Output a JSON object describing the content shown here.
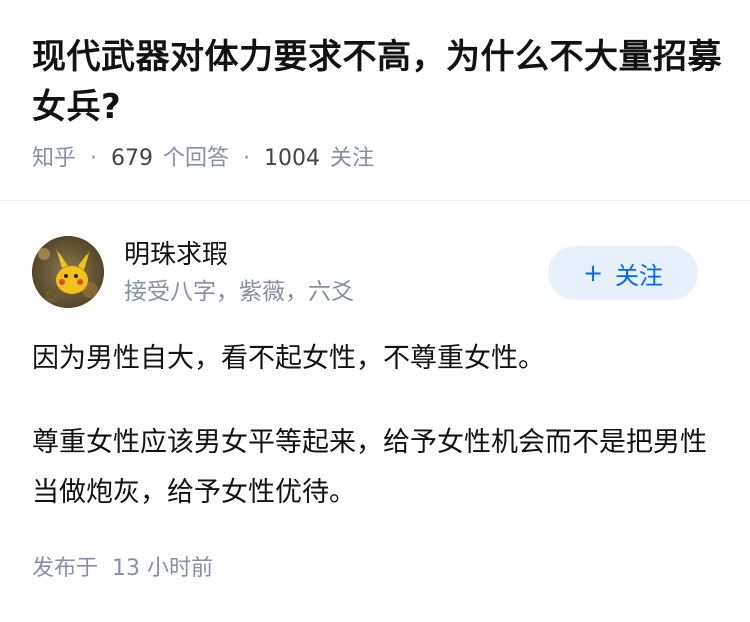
{
  "question": {
    "title": "现代武器对体力要求不高，为什么不大量招募女兵?",
    "source": "知乎",
    "answer_count": "679",
    "answer_label": "个回答",
    "follow_count": "1004",
    "follow_label": "关注"
  },
  "author": {
    "name": "明珠求瑕",
    "bio": "接受八字，紫薇，六爻",
    "follow_button": "关注",
    "follow_icon": "plus-icon"
  },
  "answer": {
    "paragraphs": [
      "因为男性自大，看不起女性，不尊重女性。",
      "尊重女性应该男女平等起来，给予女性机会而不是把男性当做炮灰，给予女性优待。"
    ]
  },
  "footer": {
    "published_label": "发布于",
    "time": "13 小时前"
  },
  "colors": {
    "accent": "#0066ff",
    "follow_bg": "#e8f1fb",
    "meta_gray": "#8590a6",
    "text": "#121212"
  }
}
